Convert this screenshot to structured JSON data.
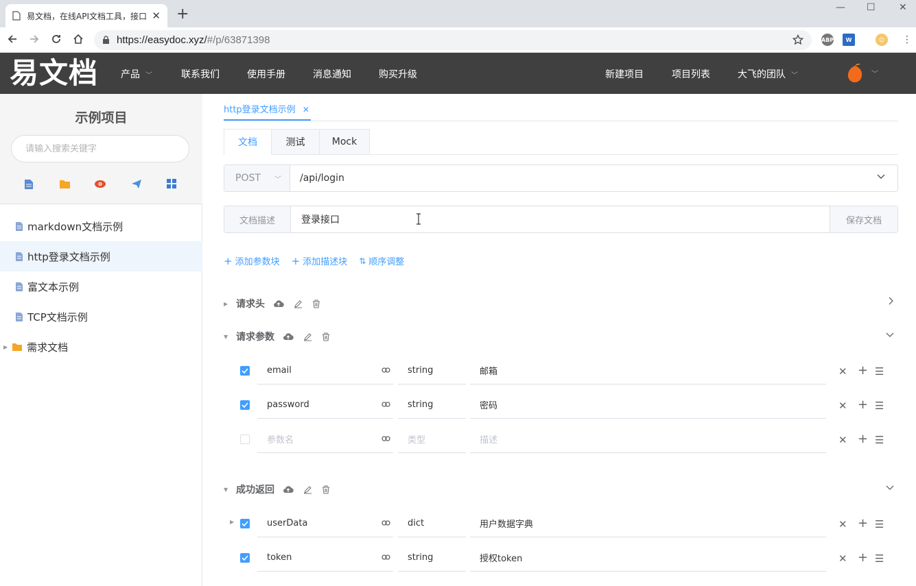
{
  "browser": {
    "tab_title": "易文档，在线API文档工具，接口...",
    "url_host": "https://easydoc.xyz/",
    "url_path": "#/p/63871398",
    "win_min": "—",
    "win_max": "☐",
    "win_close": "✕",
    "new_tab": "+",
    "ext_abp": "ABP"
  },
  "topnav": {
    "logo": "易文档",
    "items": [
      "产品",
      "联系我们",
      "使用手册",
      "消息通知",
      "购买升级"
    ],
    "right_items": [
      "新建项目",
      "项目列表",
      "大飞的团队"
    ]
  },
  "sidebar": {
    "title": "示例项目",
    "search_placeholder": "请输入搜索关键字",
    "items": [
      {
        "label": "markdown文档示例"
      },
      {
        "label": "http登录文档示例"
      },
      {
        "label": "富文本示例"
      },
      {
        "label": "TCP文档示例"
      },
      {
        "label": "需求文档"
      }
    ]
  },
  "doc": {
    "tab_label": "http登录文档示例",
    "subtabs": [
      "文档",
      "测试",
      "Mock"
    ],
    "method": "POST",
    "url": "/api/login",
    "desc_label": "文档描述",
    "desc_value": "登录接口",
    "save_label": "保存文档",
    "actions": [
      "添加参数块",
      "添加描述块",
      "顺序调整"
    ]
  },
  "sections": {
    "headers": {
      "title": "请求头"
    },
    "params": {
      "title": "请求参数",
      "rows": [
        {
          "name": "email",
          "type": "string",
          "desc": "邮箱"
        },
        {
          "name": "password",
          "type": "string",
          "desc": "密码"
        }
      ],
      "empty": {
        "name": "参数名",
        "type": "类型",
        "desc": "描述"
      }
    },
    "success": {
      "title": "成功返回",
      "rows": [
        {
          "name": "userData",
          "type": "dict",
          "desc": "用户数据字典"
        },
        {
          "name": "token",
          "type": "string",
          "desc": "授权token"
        }
      ]
    }
  },
  "colors": {
    "accent": "#409eff",
    "nav_bg": "#404040"
  }
}
